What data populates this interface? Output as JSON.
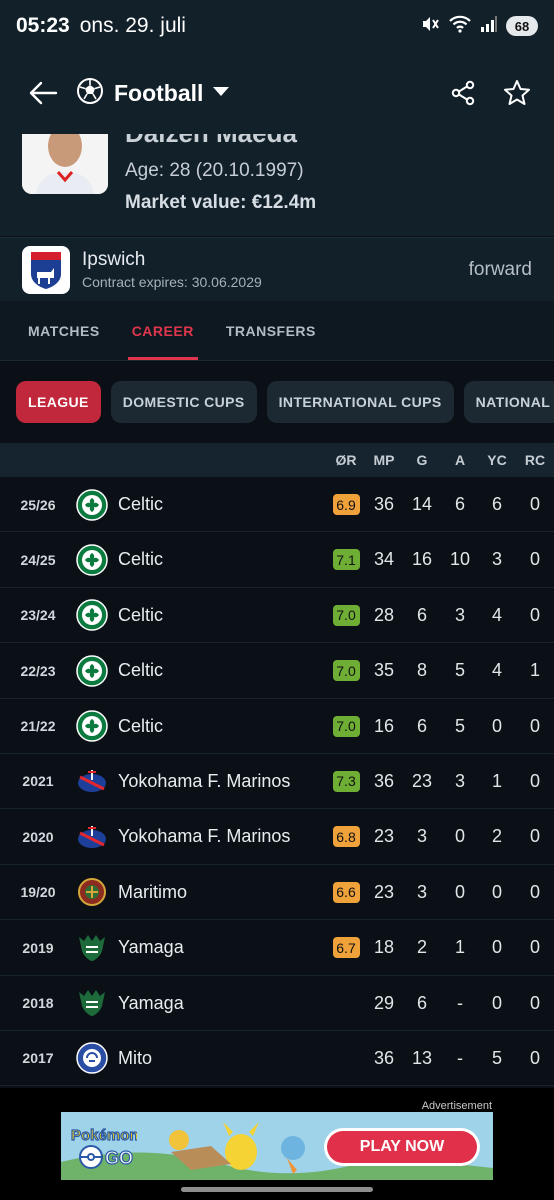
{
  "status": {
    "time": "05:23",
    "date": "ons. 29. juli",
    "battery": "68"
  },
  "appbar": {
    "sport": "Football"
  },
  "player": {
    "name": "Daizen Maeda",
    "age": "Age: 28 (20.10.1997)",
    "market_value": "Market value: €12.4m"
  },
  "club": {
    "name": "Ipswich",
    "contract": "Contract expires: 30.06.2029",
    "position": "forward"
  },
  "tabs": [
    "MATCHES",
    "CAREER",
    "TRANSFERS"
  ],
  "chips": [
    "LEAGUE",
    "DOMESTIC CUPS",
    "INTERNATIONAL CUPS",
    "NATIONAL"
  ],
  "columns": {
    "rating": "ØR",
    "mp": "MP",
    "g": "G",
    "a": "A",
    "yc": "YC",
    "rc": "RC"
  },
  "colors": {
    "accent": "#e0364d",
    "rating_green": "#6fae35",
    "rating_orange": "#efa13a"
  },
  "rows": [
    {
      "season": "25/26",
      "team": "Celtic",
      "crest": "celtic-crest-icon",
      "rating": "6.9",
      "rating_color": "#efa13a",
      "mp": "36",
      "g": "14",
      "a": "6",
      "yc": "6",
      "rc": "0"
    },
    {
      "season": "24/25",
      "team": "Celtic",
      "crest": "celtic-crest-icon",
      "rating": "7.1",
      "rating_color": "#6fae35",
      "mp": "34",
      "g": "16",
      "a": "10",
      "yc": "3",
      "rc": "0"
    },
    {
      "season": "23/24",
      "team": "Celtic",
      "crest": "celtic-crest-icon",
      "rating": "7.0",
      "rating_color": "#6fae35",
      "mp": "28",
      "g": "6",
      "a": "3",
      "yc": "4",
      "rc": "0"
    },
    {
      "season": "22/23",
      "team": "Celtic",
      "crest": "celtic-crest-icon",
      "rating": "7.0",
      "rating_color": "#6fae35",
      "mp": "35",
      "g": "8",
      "a": "5",
      "yc": "4",
      "rc": "1"
    },
    {
      "season": "21/22",
      "team": "Celtic",
      "crest": "celtic-crest-icon",
      "rating": "7.0",
      "rating_color": "#6fae35",
      "mp": "16",
      "g": "6",
      "a": "5",
      "yc": "0",
      "rc": "0"
    },
    {
      "season": "2021",
      "team": "Yokohama F. Marinos",
      "crest": "yokohama-crest-icon",
      "rating": "7.3",
      "rating_color": "#6fae35",
      "mp": "36",
      "g": "23",
      "a": "3",
      "yc": "1",
      "rc": "0"
    },
    {
      "season": "2020",
      "team": "Yokohama F. Marinos",
      "crest": "yokohama-crest-icon",
      "rating": "6.8",
      "rating_color": "#efa13a",
      "mp": "23",
      "g": "3",
      "a": "0",
      "yc": "2",
      "rc": "0"
    },
    {
      "season": "19/20",
      "team": "Maritimo",
      "crest": "maritimo-crest-icon",
      "rating": "6.6",
      "rating_color": "#efa13a",
      "mp": "23",
      "g": "3",
      "a": "0",
      "yc": "0",
      "rc": "0"
    },
    {
      "season": "2019",
      "team": "Yamaga",
      "crest": "yamaga-crest-icon",
      "rating": "6.7",
      "rating_color": "#efa13a",
      "mp": "18",
      "g": "2",
      "a": "1",
      "yc": "0",
      "rc": "0"
    },
    {
      "season": "2018",
      "team": "Yamaga",
      "crest": "yamaga-crest-icon",
      "rating": "",
      "rating_color": "",
      "mp": "29",
      "g": "6",
      "a": "-",
      "yc": "0",
      "rc": "0"
    },
    {
      "season": "2017",
      "team": "Mito",
      "crest": "mito-crest-icon",
      "rating": "",
      "rating_color": "",
      "mp": "36",
      "g": "13",
      "a": "-",
      "yc": "5",
      "rc": "0"
    }
  ],
  "ad": {
    "label": "Advertisement",
    "cta": "PLAY NOW",
    "brand": "Pokémon GO"
  }
}
